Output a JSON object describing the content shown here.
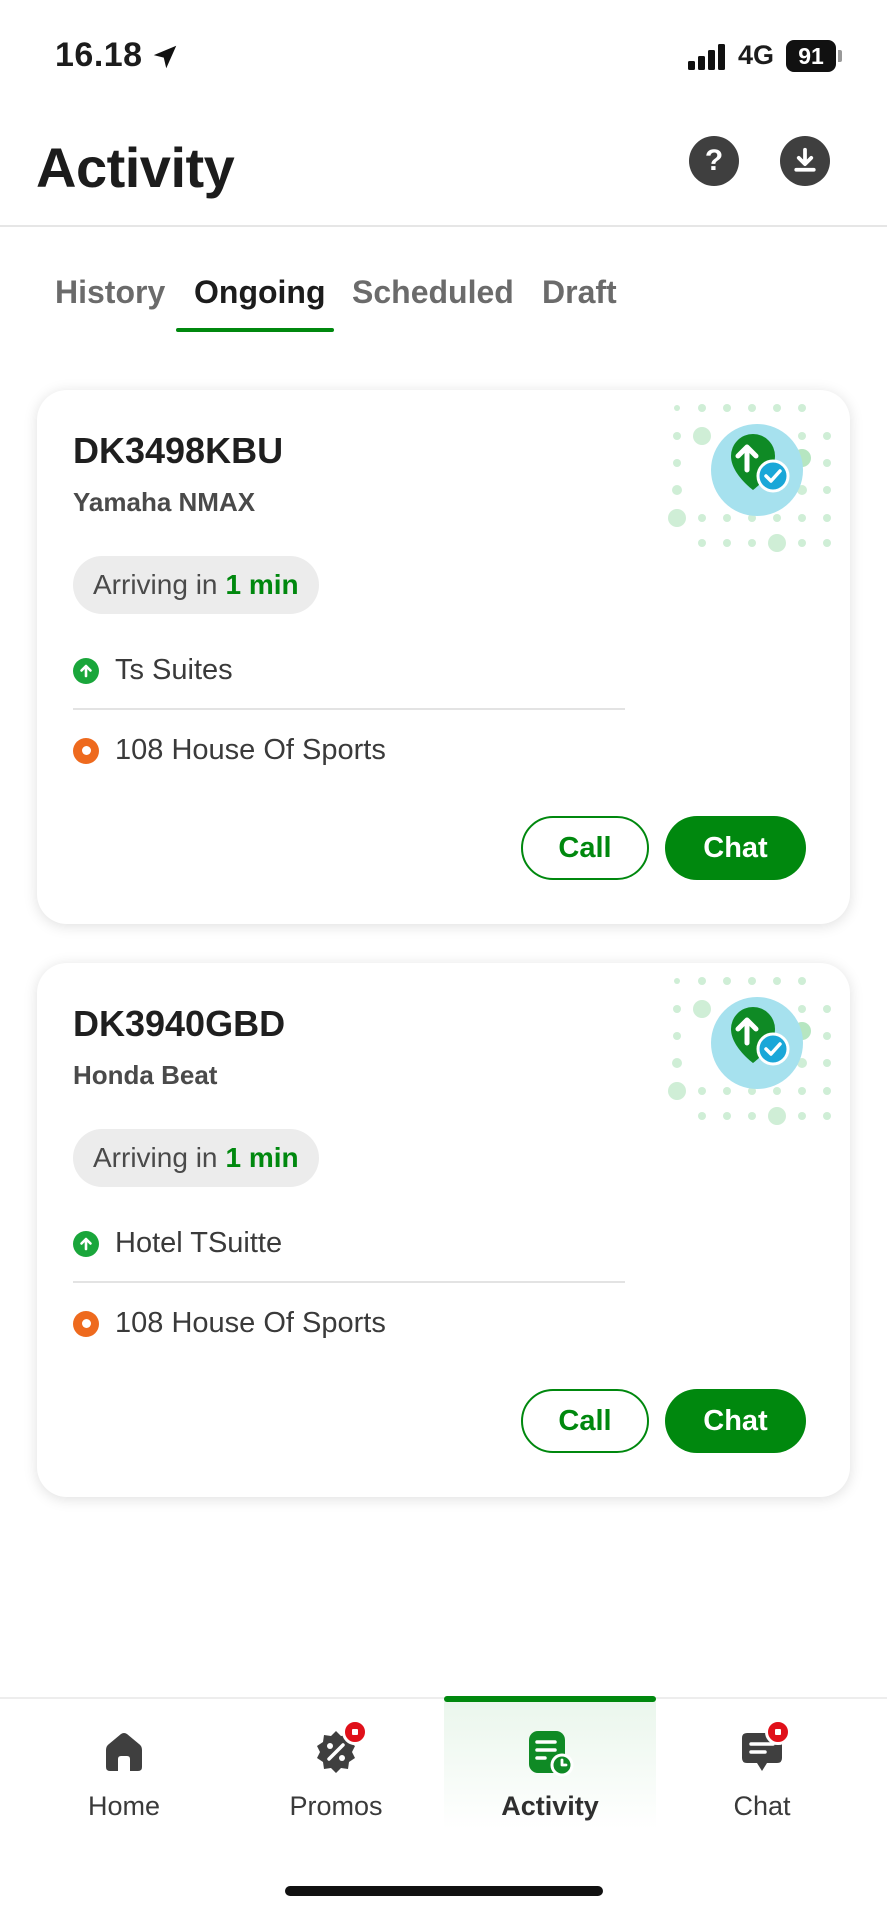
{
  "status_bar": {
    "time": "16.18",
    "network": "4G",
    "battery": "91"
  },
  "header": {
    "title": "Activity",
    "help_icon": "help-icon",
    "download_icon": "download-icon"
  },
  "tabs": [
    {
      "label": "History"
    },
    {
      "label": "Ongoing",
      "active": true
    },
    {
      "label": "Scheduled"
    },
    {
      "label": "Draft"
    }
  ],
  "rides": [
    {
      "plate": "DK3498KBU",
      "vehicle": "Yamaha NMAX",
      "eta_prefix": "Arriving in",
      "eta_value": "1 min",
      "pickup": "Ts Suites",
      "destination": "108 House Of Sports",
      "call_label": "Call",
      "chat_label": "Chat"
    },
    {
      "plate": "DK3940GBD",
      "vehicle": "Honda Beat",
      "eta_prefix": "Arriving in",
      "eta_value": "1 min",
      "pickup": "Hotel TSuitte",
      "destination": "108 House Of Sports",
      "call_label": "Call",
      "chat_label": "Chat"
    }
  ],
  "bottom_nav": [
    {
      "label": "Home",
      "icon": "home-icon"
    },
    {
      "label": "Promos",
      "icon": "promo-icon",
      "badge": true
    },
    {
      "label": "Activity",
      "icon": "activity-icon",
      "active": true
    },
    {
      "label": "Chat",
      "icon": "chat-icon",
      "badge": true
    }
  ],
  "colors": {
    "brand_green": "#00880e",
    "pickup_green": "#1aa63b",
    "destination_orange": "#ee6a1e",
    "badge_red": "#e0101a"
  }
}
